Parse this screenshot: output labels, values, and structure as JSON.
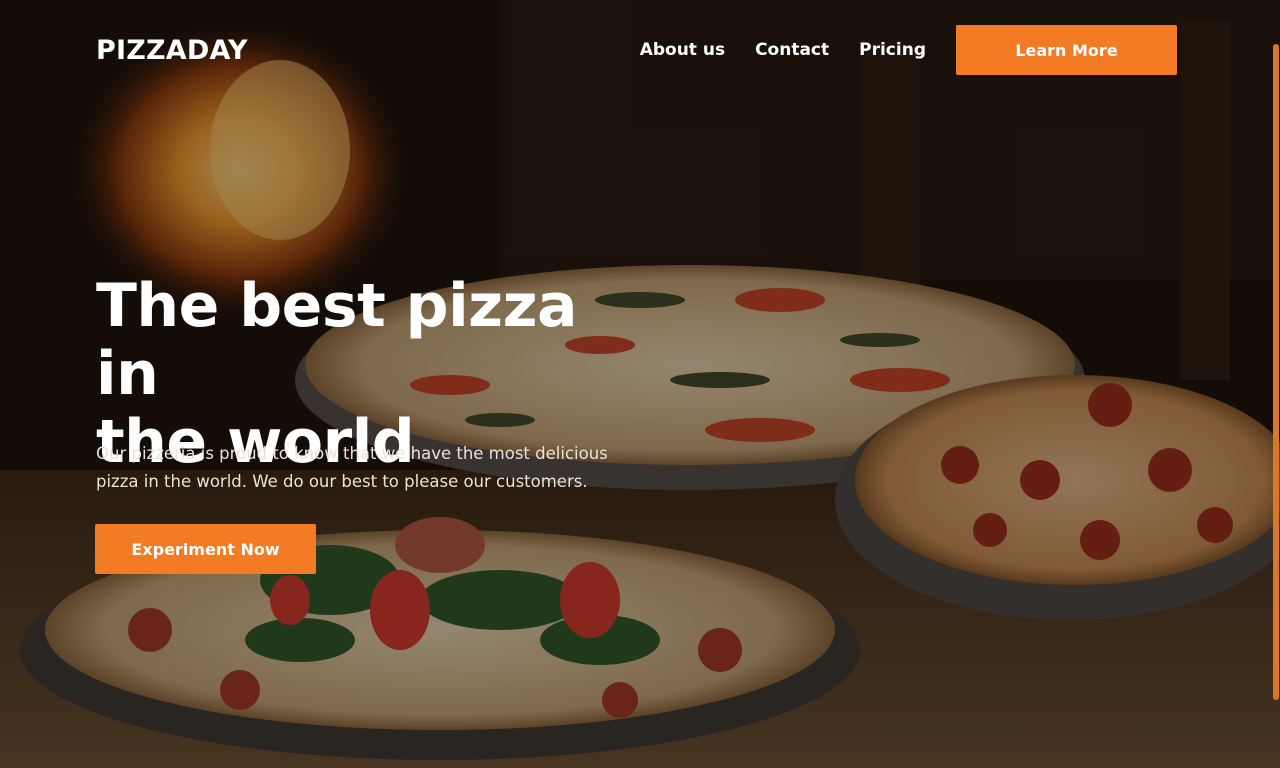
{
  "nav": {
    "logo": "PIZZADAY",
    "links": [
      {
        "label": "About us"
      },
      {
        "label": "Contact"
      },
      {
        "label": "Pricing"
      }
    ],
    "cta_label": "Learn More"
  },
  "hero": {
    "title_line1": "The best pizza in",
    "title_line2": "the world",
    "subtitle_line1": "Our pizzeria is proud to know that we have the most delicious",
    "subtitle_line2": "pizza in the world. We do our best to please our customers.",
    "cta_label": "Experiment Now"
  },
  "colors": {
    "accent": "#f27b24",
    "text": "#ffffff",
    "background": "#1a120c"
  },
  "icons": {
    "scrollbar": "vertical-scrollbar"
  }
}
